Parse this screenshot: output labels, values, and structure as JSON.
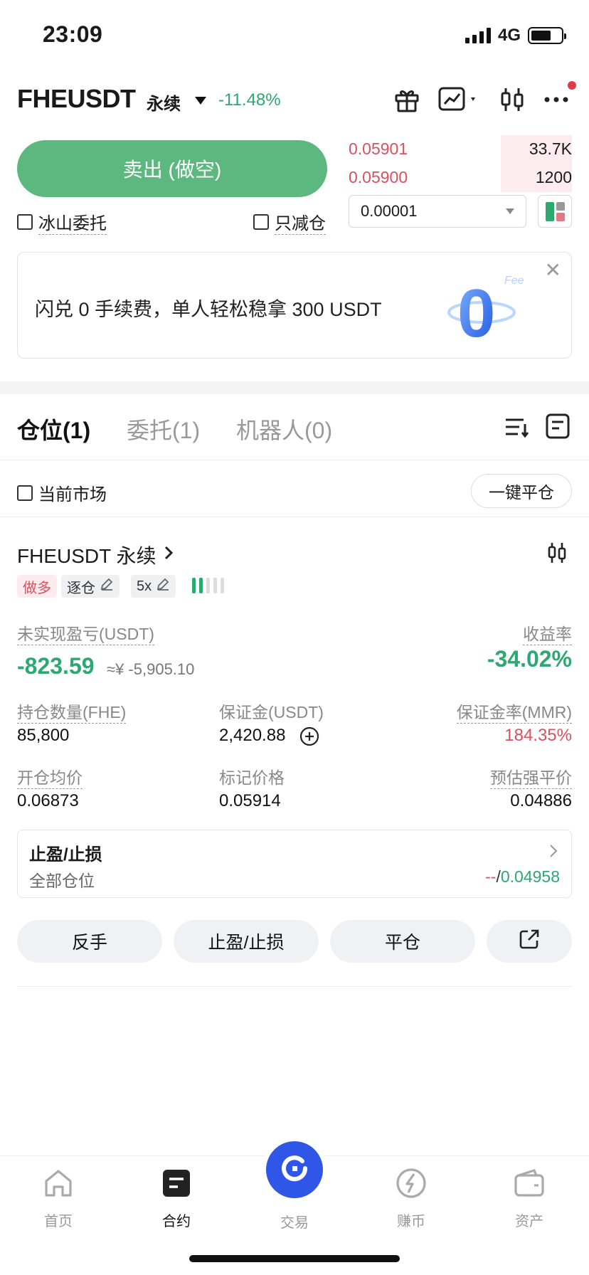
{
  "status_bar": {
    "time": "23:09",
    "network": "4G"
  },
  "header": {
    "symbol": "FHEUSDT",
    "contract_type": "永续",
    "change": "-11.48%"
  },
  "order_form": {
    "sell_button": "卖出 (做空)",
    "iceberg_label": "冰山委托",
    "reduce_only_label": "只减仓"
  },
  "order_book": {
    "asks": [
      {
        "price": "0.05901",
        "amount": "33.7K"
      },
      {
        "price": "0.05900",
        "amount": "1200"
      }
    ],
    "precision": "0.00001"
  },
  "banner": {
    "text": "闪兑 0 手续费，单人轻松稳拿 300 USDT",
    "graphic_label": "Fee",
    "graphic_digit": "0"
  },
  "tabs": [
    {
      "label": "仓位(1)",
      "active": true
    },
    {
      "label": "委托(1)",
      "active": false
    },
    {
      "label": "机器人(0)",
      "active": false
    }
  ],
  "filter": {
    "current_market_label": "当前市场",
    "close_all_label": "一键平仓"
  },
  "position": {
    "title": "FHEUSDT 永续",
    "side_tag": "做多",
    "margin_mode": "逐仓",
    "leverage": "5x",
    "unrealized_pnl_label": "未实现盈亏(USDT)",
    "unrealized_pnl": "-823.59",
    "unrealized_pnl_cny": "≈¥ -5,905.10",
    "roe_label": "收益率",
    "roe": "-34.02%",
    "size_label": "持仓数量(FHE)",
    "size": "85,800",
    "margin_label": "保证金(USDT)",
    "margin": "2,420.88",
    "mmr_label": "保证金率(MMR)",
    "mmr": "184.35%",
    "entry_label": "开仓均价",
    "entry": "0.06873",
    "mark_label": "标记价格",
    "mark": "0.05914",
    "liq_label": "预估强平价",
    "liq": "0.04886",
    "sltp_title": "止盈/止损",
    "sltp_scope": "全部仓位",
    "sltp_tp": "--",
    "sltp_sep": "/",
    "sltp_sl": "0.04958"
  },
  "actions": {
    "reverse": "反手",
    "sltp": "止盈/止损",
    "close": "平仓"
  },
  "bottom_nav": [
    {
      "label": "首页",
      "icon": "home-icon",
      "active": false
    },
    {
      "label": "合约",
      "icon": "contract-icon",
      "active": true
    },
    {
      "label": "交易",
      "icon": "trade-icon",
      "active": false
    },
    {
      "label": "赚币",
      "icon": "earn-icon",
      "active": false
    },
    {
      "label": "资产",
      "icon": "wallet-icon",
      "active": false
    }
  ],
  "colors": {
    "green": "#2ca870",
    "button_green": "#5db87f",
    "red": "#d9505f",
    "brand_blue": "#2f56e6"
  }
}
